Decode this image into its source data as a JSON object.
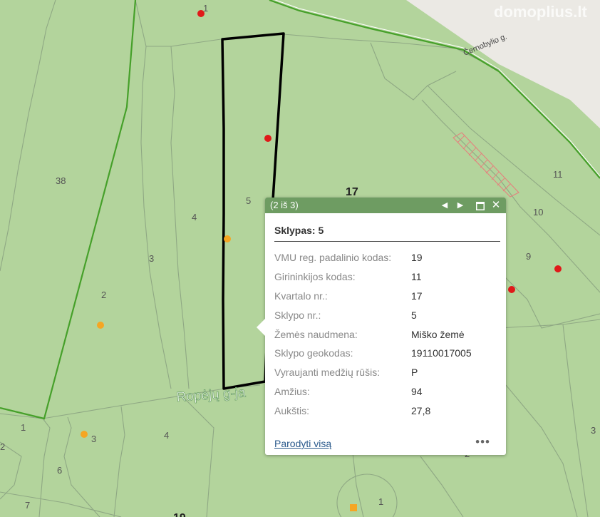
{
  "watermark": "domoplius.lt",
  "map": {
    "street_label": "Ropėjų g-ja",
    "road_label": "Černobylio g.",
    "compartment_label": "17",
    "compartment_label_bottom": "19",
    "parcel_numbers": [
      "1",
      "38",
      "4",
      "5",
      "3",
      "2",
      "11",
      "10",
      "9",
      "1",
      "3",
      "4",
      "6",
      "2",
      "7",
      "1",
      "3",
      "2"
    ],
    "colors": {
      "forest": "#b3d49c",
      "boundary_line": "#8fa884",
      "green_border": "#46a02a",
      "selection_outline": "#000000",
      "urban_area": "#ebe9e4",
      "red_point": "#e01919",
      "orange_point": "#f5a623",
      "hatch": "#e87c7c"
    }
  },
  "popup": {
    "header": {
      "counter": "(2 iš 3)",
      "prev_icon": "◀",
      "next_icon": "▶",
      "maximize_icon": "maximize-icon",
      "close_icon": "✕"
    },
    "title": "Sklypas: 5",
    "attributes": [
      {
        "key": "VMU reg. padalinio kodas:",
        "value": "19"
      },
      {
        "key": "Girininkijos kodas:",
        "value": "11"
      },
      {
        "key": "Kvartalo nr.:",
        "value": "17"
      },
      {
        "key": "Sklypo nr.:",
        "value": "5"
      },
      {
        "key": "Žemės naudmena:",
        "value": "Miško žemė"
      },
      {
        "key": "Sklypo geokodas:",
        "value": "19110017005"
      },
      {
        "key": "Vyraujanti medžių rūšis:",
        "value": "P"
      },
      {
        "key": "Amžius:",
        "value": "94"
      },
      {
        "key": "Aukštis:",
        "value": "27,8"
      }
    ],
    "footer": {
      "show_all": "Parodyti visą",
      "more": "•••"
    }
  }
}
